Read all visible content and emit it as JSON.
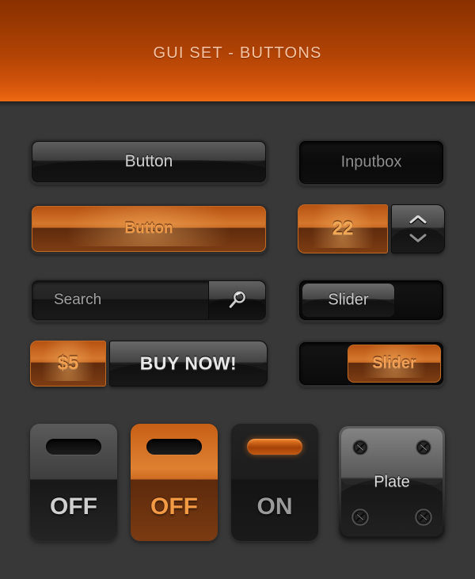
{
  "header": {
    "title": "GUI SET - BUTTONS",
    "bg_top": "#8a3000",
    "bg_bottom": "#ef6a12",
    "title_color": "#f7c3a0"
  },
  "theme": {
    "page_bg": "#383838",
    "accent_orange": "#d4762c",
    "accent_orange_text": "#ef9a49",
    "dark_panel": "#2a2a2a",
    "light_text": "#cfcfcf"
  },
  "widgets": {
    "dark_button": {
      "label": "Button"
    },
    "orange_button": {
      "label": "Button"
    },
    "inputbox": {
      "value": "Inputbox",
      "placeholder": "Inputbox"
    },
    "spinner": {
      "value": "22",
      "up_icon": "chevron-up-icon",
      "down_icon": "chevron-down-icon"
    },
    "search": {
      "placeholder": "Search",
      "value": "Search",
      "icon": "magnifier-icon"
    },
    "slider_dark": {
      "label": "Slider",
      "knob_position": "left"
    },
    "slider_orange": {
      "label": "Slider",
      "knob_position": "right"
    },
    "buy": {
      "price": "$5",
      "cta": "BUY NOW!"
    },
    "toggle_off_dark": {
      "label": "OFF",
      "state": "off"
    },
    "toggle_off_orange": {
      "label": "OFF",
      "state": "off"
    },
    "toggle_on": {
      "label": "ON",
      "state": "on"
    },
    "plate": {
      "label": "Plate",
      "screw_icon": "screw-icon"
    }
  }
}
